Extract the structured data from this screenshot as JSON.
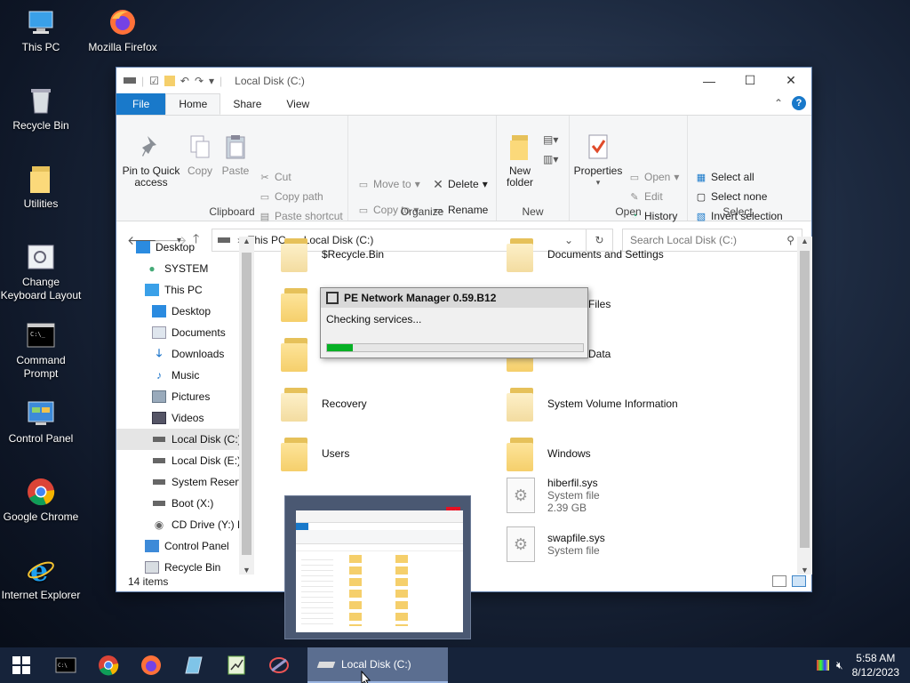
{
  "desktop": {
    "icons": [
      {
        "label": "This PC",
        "icon": "this-pc-icon"
      },
      {
        "label": "Mozilla Firefox",
        "icon": "firefox-icon"
      },
      {
        "label": "Recycle Bin",
        "icon": "recycle-bin-icon"
      },
      {
        "label": "Utilities",
        "icon": "folder-icon"
      },
      {
        "label": "Change Keyboard Layout",
        "icon": "keyboard-layout-icon"
      },
      {
        "label": "Command Prompt",
        "icon": "cmd-icon"
      },
      {
        "label": "Control Panel",
        "icon": "control-panel-icon"
      },
      {
        "label": "Google Chrome",
        "icon": "chrome-icon"
      },
      {
        "label": "Internet Explorer",
        "icon": "ie-icon"
      }
    ]
  },
  "window": {
    "title": "Local Disk (C:)",
    "tabs": {
      "file": "File",
      "home": "Home",
      "share": "Share",
      "view": "View"
    },
    "ribbon": {
      "clipboard": {
        "label": "Clipboard",
        "pin": "Pin to Quick access",
        "copy": "Copy",
        "paste": "Paste",
        "cut": "Cut",
        "copy_path": "Copy path",
        "paste_shortcut": "Paste shortcut"
      },
      "organize": {
        "label": "Organize",
        "move_to": "Move to",
        "copy_to": "Copy to",
        "delete": "Delete",
        "rename": "Rename"
      },
      "new": {
        "label": "New",
        "new_folder": "New folder"
      },
      "open": {
        "label": "Open",
        "properties": "Properties",
        "open": "Open",
        "edit": "Edit",
        "history": "History"
      },
      "select": {
        "label": "Select",
        "select_all": "Select all",
        "select_none": "Select none",
        "invert": "Invert selection"
      }
    },
    "address": {
      "crumbs": [
        "This PC",
        "Local Disk (C:)"
      ],
      "search_placeholder": "Search Local Disk (C:)"
    },
    "nav": [
      {
        "label": "Desktop",
        "level": 0
      },
      {
        "label": "SYSTEM",
        "level": 1
      },
      {
        "label": "This PC",
        "level": 1
      },
      {
        "label": "Desktop",
        "level": 2
      },
      {
        "label": "Documents",
        "level": 2
      },
      {
        "label": "Downloads",
        "level": 2
      },
      {
        "label": "Music",
        "level": 2
      },
      {
        "label": "Pictures",
        "level": 2
      },
      {
        "label": "Videos",
        "level": 2
      },
      {
        "label": "Local Disk (C:)",
        "level": 2,
        "selected": true
      },
      {
        "label": "Local Disk (E:)",
        "level": 2
      },
      {
        "label": "System Reserve",
        "level": 2
      },
      {
        "label": "Boot (X:)",
        "level": 2
      },
      {
        "label": "CD Drive (Y:) H",
        "level": 2
      },
      {
        "label": "Control Panel",
        "level": 1
      },
      {
        "label": "Recycle Bin",
        "level": 1
      }
    ],
    "files": [
      {
        "name": "$Recycle.Bin",
        "type": "folder-ghost"
      },
      {
        "name": "Documents and Settings",
        "type": "folder-ghost"
      },
      {
        "name": "",
        "type": "folder"
      },
      {
        "name": "Files",
        "type": "folder"
      },
      {
        "name": "",
        "type": "folder"
      },
      {
        "name": "Data",
        "type": "folder"
      },
      {
        "name": "Recovery",
        "type": "folder-ghost"
      },
      {
        "name": "System Volume Information",
        "type": "folder-ghost"
      },
      {
        "name": "Users",
        "type": "folder"
      },
      {
        "name": "Windows",
        "type": "folder"
      },
      {
        "name": "",
        "type": "file"
      },
      {
        "name": "hiberfil.sys",
        "type": "file",
        "kind": "System file",
        "size": "2.39 GB"
      },
      {
        "name": "",
        "type": "hidden"
      },
      {
        "name": "swapfile.sys",
        "type": "file",
        "kind": "System file",
        "size": ""
      }
    ],
    "status": "14 items"
  },
  "dialog": {
    "title": "PE Network Manager 0.59.B12",
    "message": "Checking services...",
    "progress": 0.1,
    "progress_color": "#06b025"
  },
  "taskbar": {
    "active_label": "Local Disk (C:)",
    "time": "5:58 AM",
    "date": "8/12/2023"
  }
}
